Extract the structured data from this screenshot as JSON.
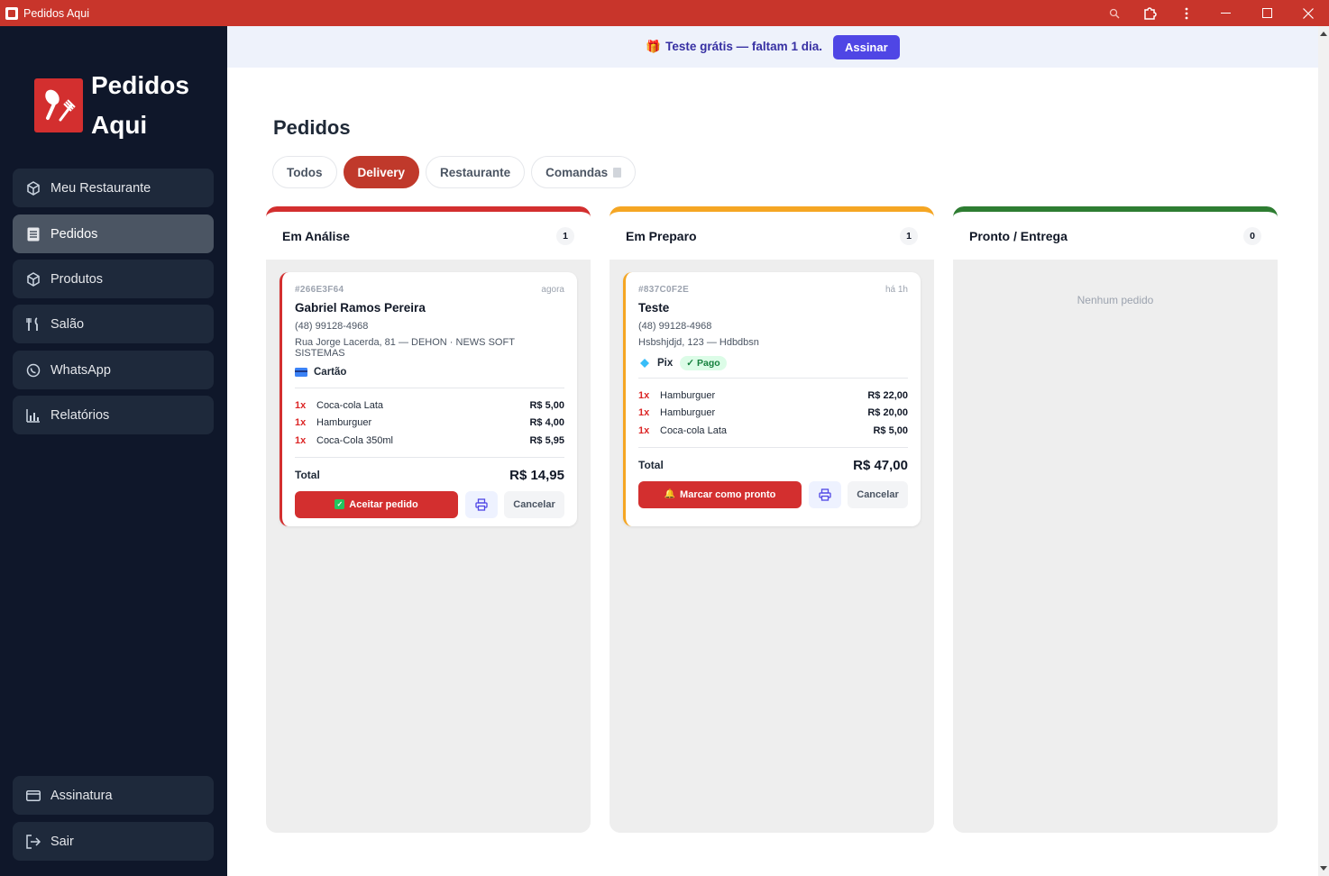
{
  "window": {
    "title": "Pedidos Aqui"
  },
  "sidebar": {
    "logo": {
      "line1": "Pedidos",
      "line2": "Aqui"
    },
    "items": [
      {
        "label": "Meu Restaurante",
        "icon": "box-icon"
      },
      {
        "label": "Pedidos",
        "icon": "list-icon",
        "active": true
      },
      {
        "label": "Produtos",
        "icon": "box-icon"
      },
      {
        "label": "Salão",
        "icon": "utensils-icon"
      },
      {
        "label": "WhatsApp",
        "icon": "whatsapp-icon"
      },
      {
        "label": "Relatórios",
        "icon": "chart-icon"
      }
    ],
    "bottom_items": [
      {
        "label": "Assinatura",
        "icon": "credit-card-icon"
      },
      {
        "label": "Sair",
        "icon": "logout-icon"
      }
    ]
  },
  "trial_banner": {
    "prefix": "Teste grátis — faltam ",
    "days": "1",
    "suffix": " dia.",
    "button": "Assinar"
  },
  "page": {
    "title": "Pedidos"
  },
  "tabs": [
    {
      "label": "Todos"
    },
    {
      "label": "Delivery",
      "active": true
    },
    {
      "label": "Restaurante"
    },
    {
      "label": "Comandas"
    }
  ],
  "columns": [
    {
      "title": "Em Análise",
      "count": "1",
      "color": "#d32f2f",
      "orders": [
        {
          "id": "#266E3F64",
          "time": "agora",
          "customer": "Gabriel Ramos Pereira",
          "phone": "(48) 99128-4968",
          "address": "Rua Jorge Lacerda, 81 — DEHON · NEWS SOFT SISTEMAS",
          "payment": "Cartão",
          "items": [
            {
              "qty": "1x",
              "name": "Coca-cola Lata",
              "price": "R$ 5,00"
            },
            {
              "qty": "1x",
              "name": "Hamburguer",
              "price": "R$ 4,00"
            },
            {
              "qty": "1x",
              "name": "Coca-Cola 350ml",
              "price": "R$ 5,95"
            }
          ],
          "total_label": "Total",
          "total": "R$ 14,95",
          "primary_action": "Aceitar pedido",
          "cancel": "Cancelar"
        }
      ]
    },
    {
      "title": "Em Preparo",
      "count": "1",
      "color": "#f5a623",
      "orders": [
        {
          "id": "#837C0F2E",
          "time": "há 1h",
          "customer": "Teste",
          "phone": "(48) 99128-4968",
          "address": "Hsbshjdjd, 123 — Hdbdbsn",
          "payment": "Pix",
          "paid_badge": "✓ Pago",
          "items": [
            {
              "qty": "1x",
              "name": "Hamburguer",
              "price": "R$ 22,00"
            },
            {
              "qty": "1x",
              "name": "Hamburguer",
              "price": "R$ 20,00"
            },
            {
              "qty": "1x",
              "name": "Coca-cola Lata",
              "price": "R$ 5,00"
            }
          ],
          "total_label": "Total",
          "total": "R$ 47,00",
          "primary_action": "Marcar como pronto",
          "cancel": "Cancelar"
        }
      ]
    },
    {
      "title": "Pronto / Entrega",
      "count": "0",
      "color": "#2e7d32",
      "empty_text": "Nenhum pedido"
    }
  ]
}
